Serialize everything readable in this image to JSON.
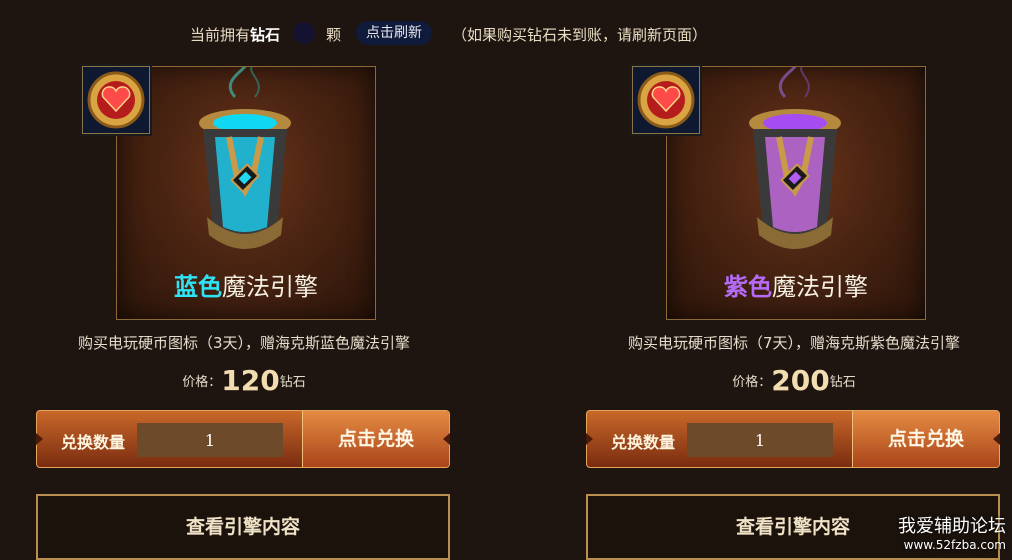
{
  "header": {
    "prefix": "当前拥有",
    "currency": "钻石",
    "unit": "颗",
    "refresh_label": "点击刷新",
    "note": "（如果购买钻石未到账，请刷新页面）"
  },
  "products": [
    {
      "color_word": "蓝色",
      "name_rest": "魔法引擎",
      "accent": "#2ee3f5",
      "description": "购买电玩硬币图标（3天），赠海克斯蓝色魔法引擎",
      "price_label": "价格：",
      "price_value": "120",
      "price_unit": "钻石",
      "qty_label": "兑换数量",
      "qty_value": "1",
      "exchange_label": "点击兑换",
      "view_label": "查看引擎内容"
    },
    {
      "color_word": "紫色",
      "name_rest": "魔法引擎",
      "accent": "#b56bf7",
      "description": "购买电玩硬币图标（7天），赠海克斯紫色魔法引擎",
      "price_label": "价格：",
      "price_value": "200",
      "price_unit": "钻石",
      "qty_label": "兑换数量",
      "qty_value": "1",
      "exchange_label": "点击兑换",
      "view_label": "查看引擎内容"
    }
  ],
  "watermark": {
    "line1": "我爱辅助论坛",
    "line2": "www.52fzba.com"
  }
}
